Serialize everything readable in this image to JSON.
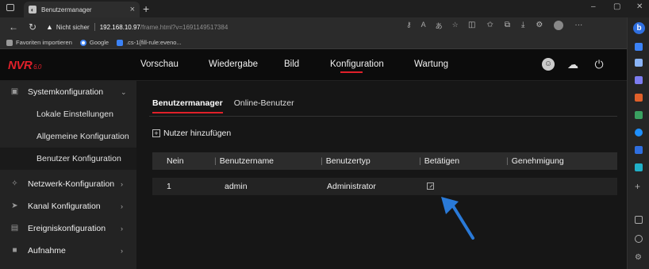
{
  "browser": {
    "tab_title": "Benutzermanager",
    "tab_close": "×",
    "new_tab": "+",
    "win_controls": [
      "–",
      "▢",
      "✕"
    ],
    "security_label": "Nicht sicher",
    "url_host": "192.168.10.97",
    "url_path": "/frame.html?v=1691149517384",
    "favorites": [
      "Favoriten importieren",
      "Google",
      ".cs-1{fill-rule:eveno..."
    ]
  },
  "app": {
    "logo": "NVR",
    "logo_version": "6.0",
    "menu": [
      "Vorschau",
      "Wiedergabe",
      "Bild",
      "Konfiguration",
      "Wartung"
    ],
    "active_menu": "Konfiguration"
  },
  "sidebar": {
    "items": [
      {
        "label": "Systemkonfiguration",
        "icon": "system-icon",
        "chevron": "⌄"
      },
      {
        "label": "Netzwerk-Konfiguration",
        "icon": "network-icon",
        "chevron": "›"
      },
      {
        "label": "Kanal Konfiguration",
        "icon": "camera-icon",
        "chevron": "›"
      },
      {
        "label": "Ereigniskonfiguration",
        "icon": "event-icon",
        "chevron": "›"
      },
      {
        "label": "Aufnahme",
        "icon": "record-icon",
        "chevron": "›"
      }
    ],
    "sub_items": [
      "Lokale Einstellungen",
      "Allgemeine Konfiguration",
      "Benutzer Konfiguration"
    ],
    "active_sub": "Benutzer Konfiguration"
  },
  "content": {
    "tabs": [
      "Benutzermanager",
      "Online-Benutzer"
    ],
    "add_user": "Nutzer hinzufügen",
    "columns": [
      "Nein",
      "Benutzername",
      "Benutzertyp",
      "Betätigen",
      "Genehmigung"
    ],
    "rows": [
      {
        "no": "1",
        "username": "admin",
        "usertype": "Administrator"
      }
    ]
  },
  "colors": {
    "accent": "#e0202a",
    "arrow": "#2a7ad8"
  }
}
